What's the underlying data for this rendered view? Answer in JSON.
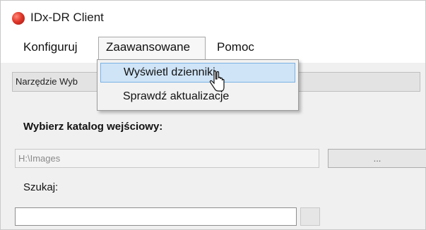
{
  "window": {
    "title": "IDx-DR Client",
    "icon": "app-red-circle-icon"
  },
  "menubar": {
    "items": [
      "Konfiguruj",
      "Zaawansowane",
      "Pomoc"
    ],
    "active": "Zaawansowane"
  },
  "dropdown": {
    "items": [
      "Wyświetl dzienniki",
      "Sprawdź aktualizacje"
    ],
    "hovered": "Wyświetl dzienniki"
  },
  "toolbar": {
    "combo_text": "Narzędzie Wyb"
  },
  "input_section": {
    "label": "Wybierz katalog wejściowy:",
    "path_value": "H:\\Images",
    "browse_label": "..."
  },
  "search": {
    "label": "Szukaj:",
    "value": ""
  },
  "colors": {
    "menu_hover": "#cfe4f7",
    "menu_hover_border": "#7ab2e3",
    "app_icon": "#e0372a"
  }
}
